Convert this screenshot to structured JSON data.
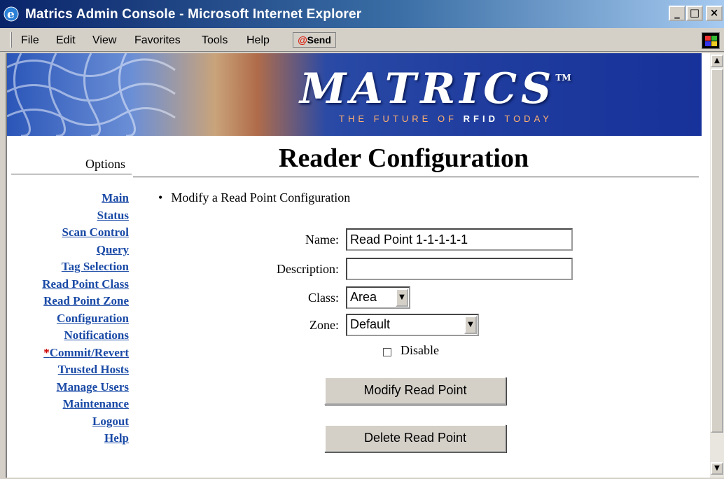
{
  "window": {
    "title": "Matrics Admin Console - Microsoft Internet Explorer"
  },
  "menubar": {
    "items": [
      "File",
      "Edit",
      "View",
      "Favorites",
      "Tools",
      "Help"
    ],
    "send_label": "Send"
  },
  "banner": {
    "logo": "MATRICS",
    "trademark": "TM",
    "tagline_pre": "THE FUTURE OF",
    "tagline_bold": "RFID",
    "tagline_post": "TODAY"
  },
  "sidebar": {
    "heading": "Options",
    "items": [
      {
        "label": "Main"
      },
      {
        "label": "Status"
      },
      {
        "label": "Scan Control"
      },
      {
        "label": "Query"
      },
      {
        "label": "Tag Selection"
      },
      {
        "label": "Read Point Class"
      },
      {
        "label": "Read Point Zone"
      },
      {
        "label": "Configuration"
      },
      {
        "label": "Notifications"
      },
      {
        "label": "Commit/Revert",
        "marker": "*"
      },
      {
        "label": "Trusted Hosts"
      },
      {
        "label": "Manage Users"
      },
      {
        "label": "Maintenance"
      },
      {
        "label": "Logout"
      },
      {
        "label": "Help"
      }
    ]
  },
  "main": {
    "title": "Reader Configuration",
    "section": "Modify a Read Point Configuration",
    "form": {
      "name_label": "Name:",
      "name_value": "Read Point 1-1-1-1-1",
      "description_label": "Description:",
      "description_value": "",
      "class_label": "Class:",
      "class_value": "Area",
      "zone_label": "Zone:",
      "zone_value": "Default",
      "disable_label": "Disable",
      "disable_checked": false
    },
    "buttons": {
      "modify": "Modify Read Point",
      "delete": "Delete Read Point"
    }
  }
}
